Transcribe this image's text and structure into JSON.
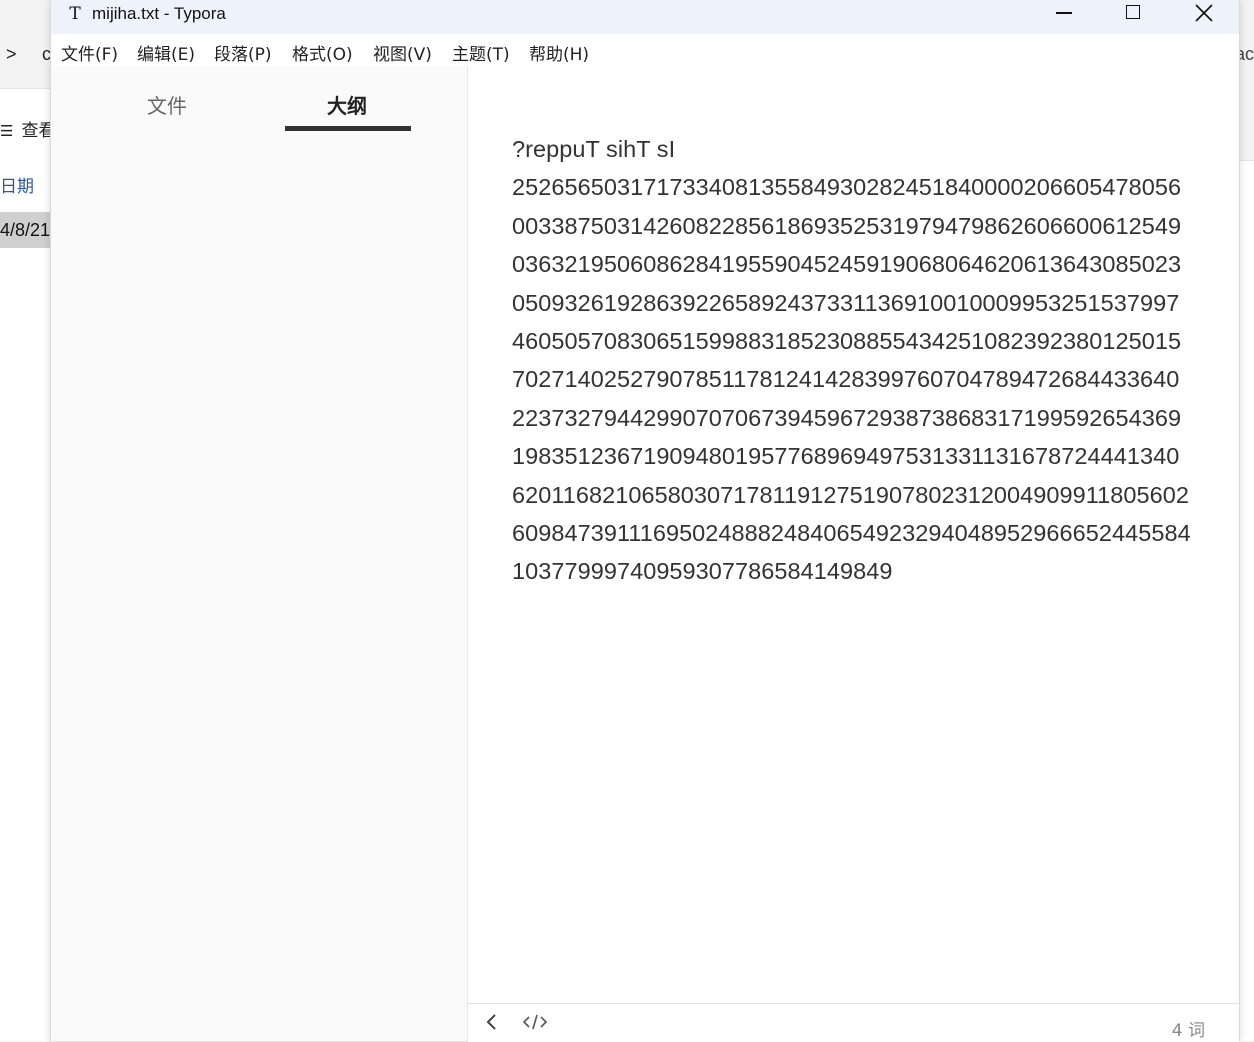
{
  "window": {
    "title": "mijiha.txt - Typora",
    "app_icon": "T"
  },
  "menu": [
    "文件(F)",
    "编辑(E)",
    "段落(P)",
    "格式(O)",
    "视图(V)",
    "主题(T)",
    "帮助(H)"
  ],
  "sidebar": {
    "tabs": [
      {
        "label": "文件",
        "active": false
      },
      {
        "label": "大纲",
        "active": true
      }
    ]
  },
  "document": {
    "text": "?reppuT sihT sI\n2526565031717334081355849302824518400002066054780560033875031426082285618693525319794798626066006125490363219506086284195590452459190680646206136430850230509326192863922658924373311369100100099532515379974605057083065159988318523088554342510823923801250157027140252790785117812414283997607047894726844336402237327944299070706739459672938738683171995926543691983512367190948019577689694975313311316787244413406201168210658030717811912751907802312004909911805602609847391116950248882484065492329404895296665244558410377999740959307786584149849"
  },
  "statusbar": {
    "word_count": "4 词"
  },
  "background_window": {
    "nav_chevron": ">",
    "partial_c": "c",
    "view_label": "查看",
    "date_header": "日期",
    "date_value": "4/8/21",
    "partial_right": "ac"
  }
}
